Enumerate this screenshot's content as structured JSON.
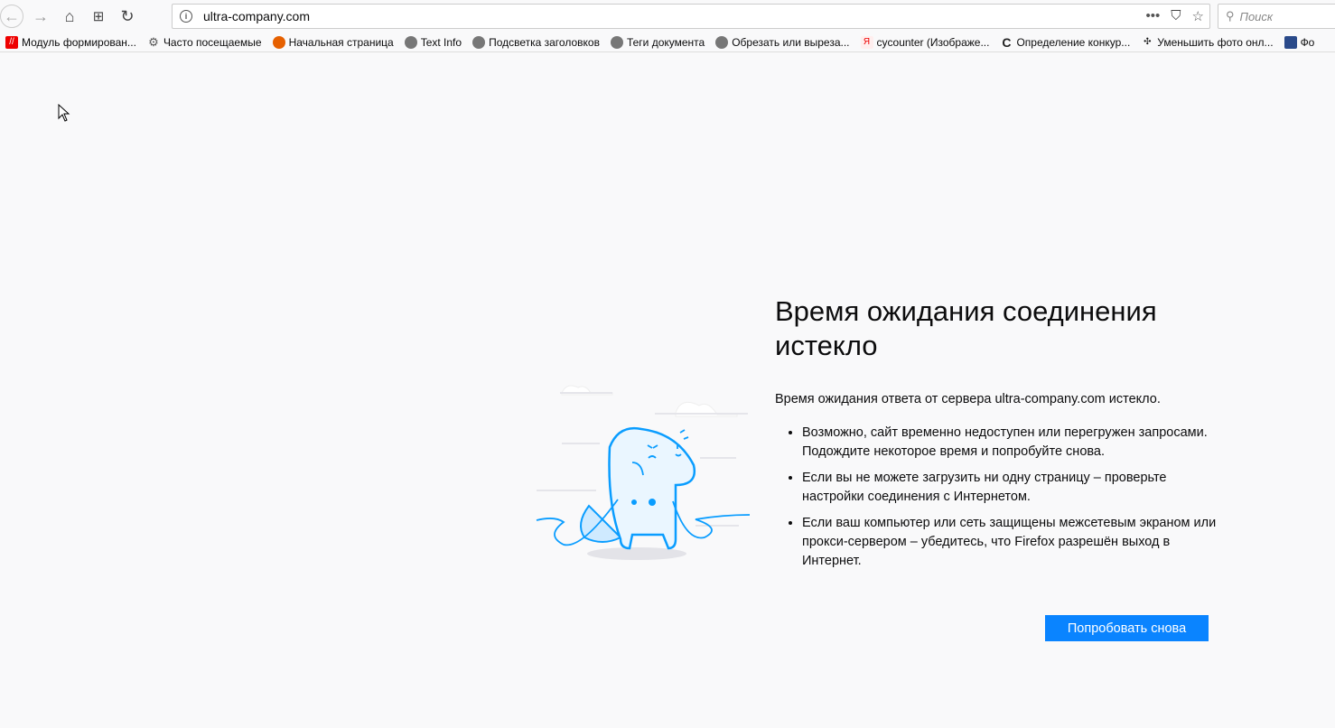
{
  "toolbar": {
    "url": "ultra-company.com",
    "search_placeholder": "Поиск"
  },
  "bookmarks": [
    {
      "label": "Модуль формирован...",
      "icon": "module-icon"
    },
    {
      "label": "Часто посещаемые",
      "icon": "gear-icon"
    },
    {
      "label": "Начальная страница",
      "icon": "firefox-icon"
    },
    {
      "label": "Text Info",
      "icon": "globe-icon"
    },
    {
      "label": "Подсветка заголовков",
      "icon": "globe-icon"
    },
    {
      "label": "Теги документа",
      "icon": "globe-icon"
    },
    {
      "label": "Обрезать или выреза...",
      "icon": "globe-icon"
    },
    {
      "label": "cycounter (Изображе...",
      "icon": "yandex-icon"
    },
    {
      "label": "Определение конкур...",
      "icon": "c-icon"
    },
    {
      "label": "Уменьшить фото онл...",
      "icon": "resize-icon"
    },
    {
      "label": "Фо",
      "icon": "search-site-icon"
    }
  ],
  "error": {
    "title": "Время ожидания соединения истекло",
    "intro": "Время ожидания ответа от сервера ultra-company.com истекло.",
    "items": [
      "Возможно, сайт временно недоступен или перегружен запросами. Подождите некоторое время и попробуйте снова.",
      "Если вы не можете загрузить ни одну страницу – проверьте настройки соединения с Интернетом.",
      "Если ваш компьютер или сеть защищены межсетевым экраном или прокси-сервером – убедитесь, что Firefox разрешён выход в Интернет."
    ],
    "retry": "Попробовать снова"
  },
  "colors": {
    "accent": "#0a84ff",
    "illustration": "#0a9dff"
  }
}
